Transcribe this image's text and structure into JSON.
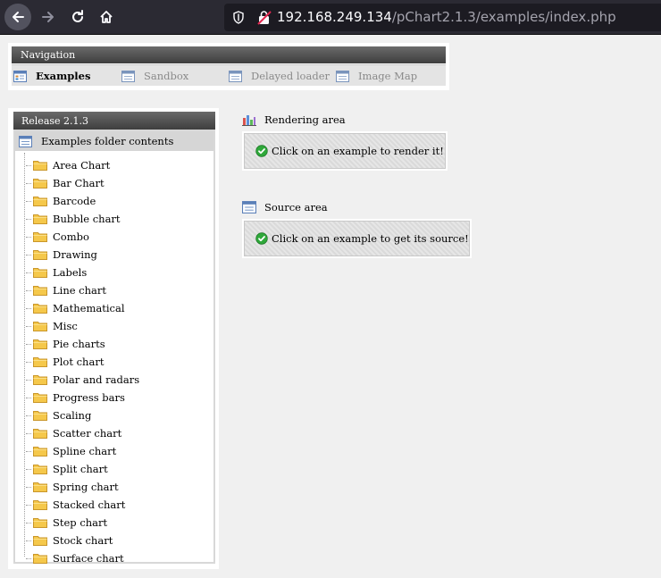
{
  "browser": {
    "url_host": "192.168.249.134",
    "url_path": "/pChart2.1.3/examples/index.php"
  },
  "navigation": {
    "title": "Navigation",
    "tabs": [
      {
        "label": "Examples",
        "active": true
      },
      {
        "label": "Sandbox",
        "active": false
      },
      {
        "label": "Delayed loader",
        "active": false
      },
      {
        "label": "Image Map",
        "active": false
      }
    ]
  },
  "release": {
    "title": "Release 2.1.3",
    "root_label": "Examples folder contents",
    "folders": [
      "Area Chart",
      "Bar Chart",
      "Barcode",
      "Bubble chart",
      "Combo",
      "Drawing",
      "Labels",
      "Line chart",
      "Mathematical",
      "Misc",
      "Pie charts",
      "Plot chart",
      "Polar and radars",
      "Progress bars",
      "Scaling",
      "Scatter chart",
      "Spline chart",
      "Split chart",
      "Spring chart",
      "Stacked chart",
      "Step chart",
      "Stock chart",
      "Surface chart"
    ]
  },
  "rendering": {
    "title": "Rendering area",
    "message": "Click on an example to render it!"
  },
  "source": {
    "title": "Source area",
    "message": "Click on an example to get its source!"
  },
  "icons": {
    "back": "back-arrow-icon",
    "forward": "forward-arrow-icon",
    "reload": "reload-icon",
    "home": "home-icon",
    "shield": "shield-icon",
    "insecure": "insecure-lock-icon",
    "folder": "folder-icon",
    "window": "window-icon",
    "chart": "bar-chart-icon",
    "check": "check-circle-icon"
  },
  "colors": {
    "chrome": "#2b2a33",
    "urlbar": "#1c1b22",
    "header": "#4a4a4a",
    "folder": "#f5c84b",
    "check": "#2fa83a"
  }
}
